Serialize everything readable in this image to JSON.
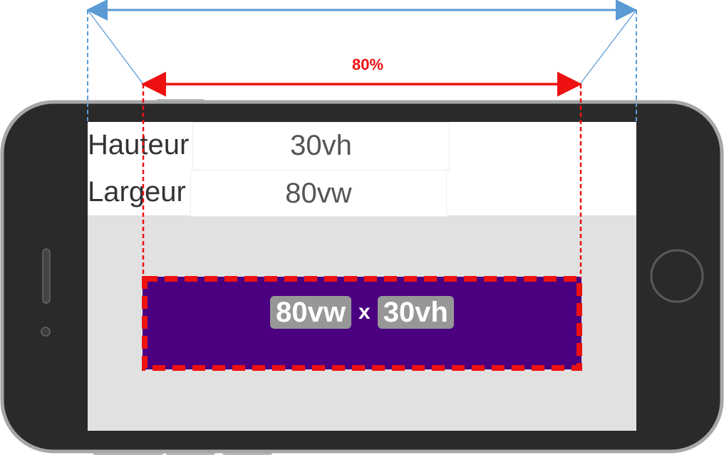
{
  "panel": {
    "rows": [
      {
        "label": "Hauteur",
        "value": "30vh"
      },
      {
        "label": "Largeur",
        "value": "80vw"
      }
    ]
  },
  "demo": {
    "width_text": "80vw",
    "separator": "x",
    "height_text": "30vh"
  },
  "annotation": {
    "width_percent_label": "80%",
    "fraction": 0.8
  },
  "colors": {
    "phone_body": "#2a2a2a",
    "screen_background": "#e1e1e1",
    "box_fill": "#4b0082",
    "dashed_outline": "#ee1111",
    "full_width_arrow": "#5b9bd5",
    "pill_background": "#979797"
  }
}
